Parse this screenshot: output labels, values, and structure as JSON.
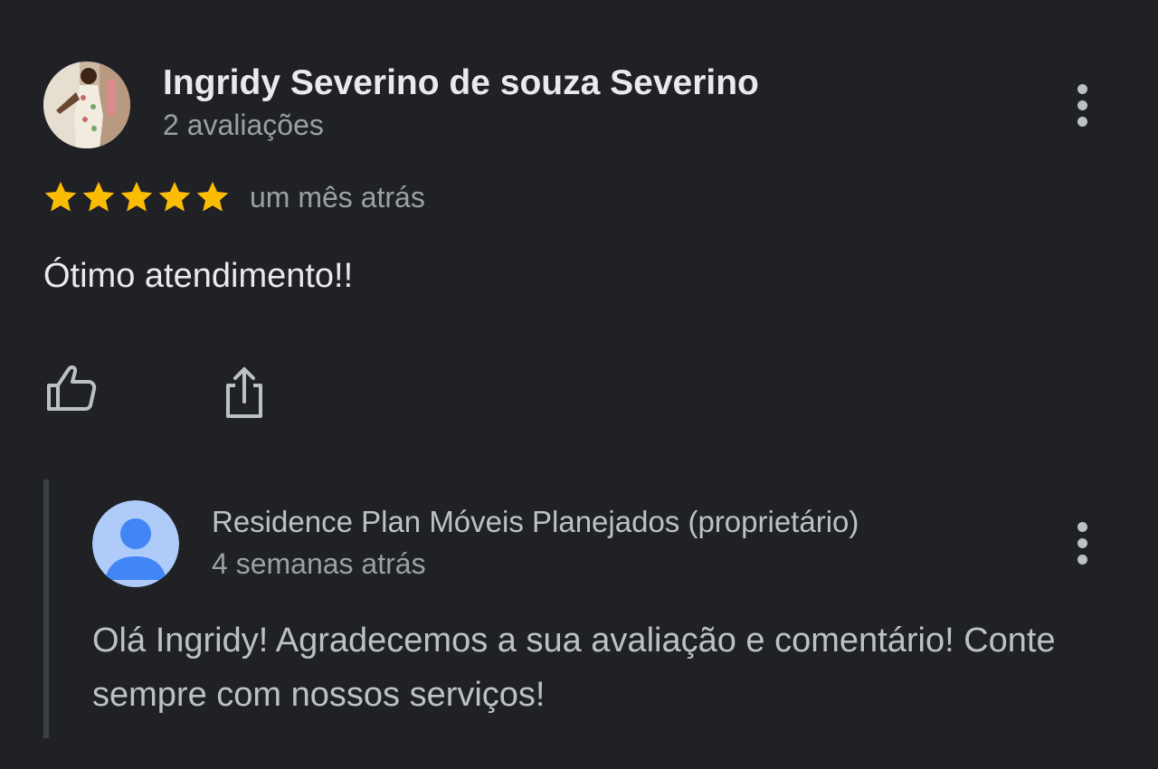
{
  "review": {
    "author": "Ingridy Severino de souza Severino",
    "review_count": "2 avaliações",
    "rating": 5,
    "max_rating": 5,
    "time": "um mês atrás",
    "text": "Ótimo atendimento!!",
    "star_color": "#fbbc04",
    "avatar_icon": "reviewer-photo",
    "actions": {
      "like_icon": "thumb-up-icon",
      "share_icon": "share-icon"
    }
  },
  "owner_reply": {
    "author": "Residence Plan Móveis Planejados (proprietário)",
    "time": "4 semanas atrás",
    "text": "Olá Ingridy! Agradecemos a sua avaliação e comentário! Conte sempre com nossos serviços!",
    "avatar_icon": "default-person-avatar",
    "avatar_bg": "#aecbfa",
    "avatar_fg": "#4285f4"
  },
  "colors": {
    "background": "#202124",
    "primary_text": "#e8eaed",
    "secondary_text": "#9aa0a6",
    "reply_bar": "#3c4043"
  }
}
